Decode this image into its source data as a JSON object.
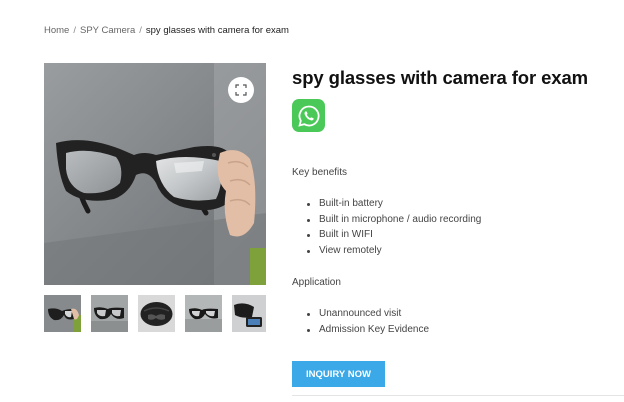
{
  "breadcrumb": {
    "home": "Home",
    "separator": "/",
    "category": "SPY Camera",
    "current": "spy glasses with camera for exam"
  },
  "product": {
    "title": "spy glasses with camera for exam",
    "whatsapp_icon": "whatsapp-icon",
    "key_benefits_heading": "Key benefits",
    "key_benefits": [
      "Built-in battery",
      "Built in microphone / audio recording",
      "Built in WIFI",
      "View remotely"
    ],
    "application_heading": "Application",
    "applications": [
      "Unannounced visit",
      "Admission Key Evidence"
    ],
    "inquiry_button": "INQUIRY NOW"
  },
  "colors": {
    "accent_button": "#3ba8e8",
    "whatsapp_green": "#4ac959"
  },
  "gallery": {
    "zoom_icon": "expand-icon",
    "thumbnail_count": 5
  }
}
